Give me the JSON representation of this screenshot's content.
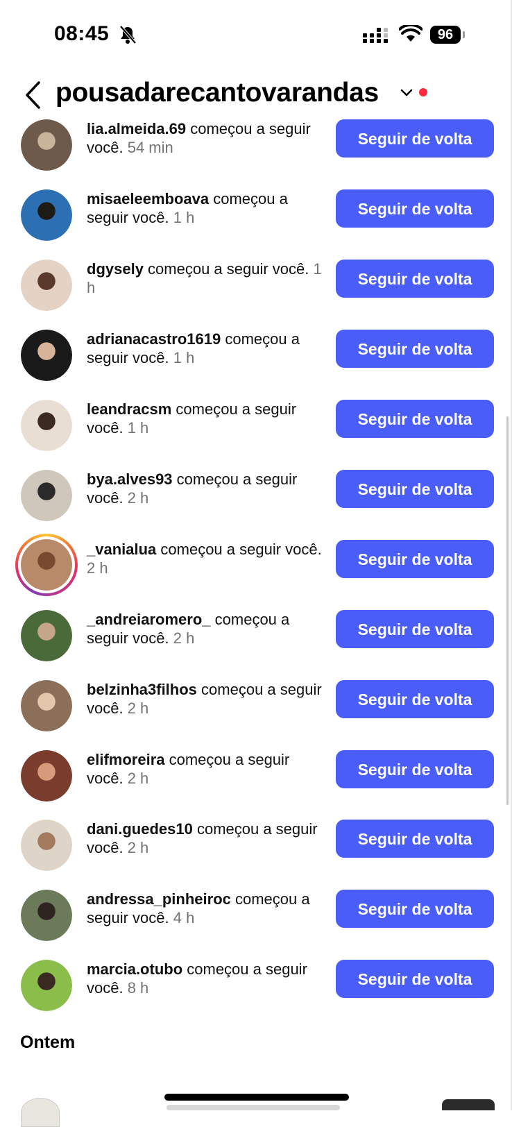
{
  "status_bar": {
    "time": "08:45",
    "battery": "96"
  },
  "header": {
    "account": "pousadarecantovarandas"
  },
  "colors": {
    "button": "#4a5df9",
    "notification_dot": "#ff2a3d",
    "timestamp": "#737373"
  },
  "follow_button_label": "Seguir de volta",
  "notifications": [
    {
      "username": "lia.almeida.69",
      "action": " começou a seguir você.",
      "time": " 54 min",
      "avatar_icon": "profile-photo"
    },
    {
      "username": "misaeleemboava",
      "action": " começou a seguir você.",
      "time": " 1 h",
      "avatar_icon": "profile-photo"
    },
    {
      "username": "dgysely",
      "action": " começou a seguir você.",
      "time": " 1 h",
      "avatar_icon": "profile-photo"
    },
    {
      "username": "adrianacastro1619",
      "action": " começou a seguir você.",
      "time": " 1 h",
      "avatar_icon": "profile-photo"
    },
    {
      "username": "leandracsm",
      "action": " começou a seguir você.",
      "time": " 1 h",
      "avatar_icon": "profile-photo"
    },
    {
      "username": "bya.alves93",
      "action": " começou a seguir você.",
      "time": " 2 h",
      "avatar_icon": "profile-photo"
    },
    {
      "username": "_vanialua",
      "action": " começou a seguir você.",
      "time": " 2 h",
      "avatar_icon": "profile-photo-story-ring"
    },
    {
      "username": "_andreiaromero_",
      "action": " começou a seguir você.",
      "time": " 2 h",
      "avatar_icon": "profile-photo"
    },
    {
      "username": "belzinha3filhos",
      "action": " começou a seguir você.",
      "time": " 2 h",
      "avatar_icon": "profile-photo"
    },
    {
      "username": "elifmoreira",
      "action": " começou a seguir você.",
      "time": " 2 h",
      "avatar_icon": "profile-photo"
    },
    {
      "username": "dani.guedes10",
      "action": " começou a seguir você.",
      "time": " 2 h",
      "avatar_icon": "profile-photo"
    },
    {
      "username": "andressa_pinheiroc",
      "action": " começou a seguir você.",
      "time": " 4 h",
      "avatar_icon": "profile-photo"
    },
    {
      "username": "marcia.otubo",
      "action": " começou a seguir você.",
      "time": " 8 h",
      "avatar_icon": "profile-photo"
    }
  ],
  "section": {
    "yesterday_label": "Ontem"
  }
}
